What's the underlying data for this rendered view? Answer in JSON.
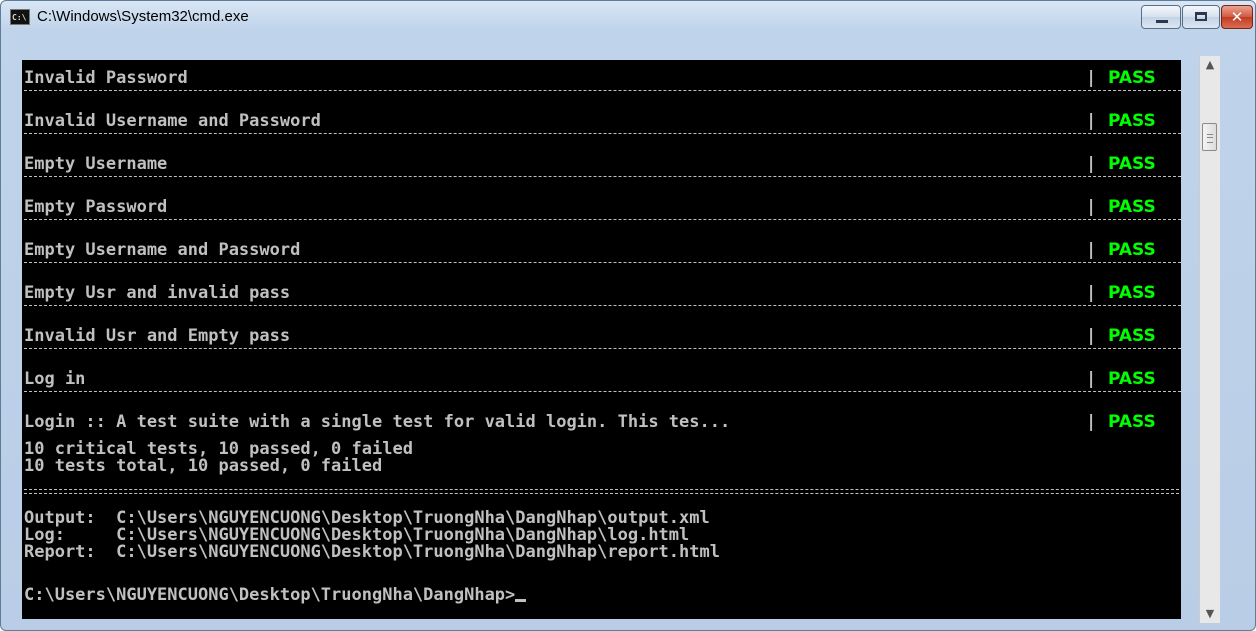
{
  "window": {
    "title": "C:\\Windows\\System32\\cmd.exe",
    "icon_text": "C:\\",
    "controls": {
      "minimize": "minimize",
      "maximize": "maximize",
      "close": "✕"
    }
  },
  "results": [
    {
      "name": "Invalid Password",
      "status": "PASS"
    },
    {
      "name": "Invalid Username and Password",
      "status": "PASS"
    },
    {
      "name": "Empty Username",
      "status": "PASS"
    },
    {
      "name": "Empty Password",
      "status": "PASS"
    },
    {
      "name": "Empty Username and Password",
      "status": "PASS"
    },
    {
      "name": "Empty Usr and invalid pass",
      "status": "PASS"
    },
    {
      "name": "Invalid Usr and Empty pass",
      "status": "PASS"
    },
    {
      "name": "Log in",
      "status": "PASS"
    },
    {
      "name": "Login :: A test suite with a single test for valid login. This tes...",
      "status": "PASS"
    }
  ],
  "separator_char": "|",
  "summary": {
    "critical": "10 critical tests, 10 passed, 0 failed",
    "total": "10 tests total, 10 passed, 0 failed"
  },
  "outputs": {
    "output": "Output:  C:\\Users\\NGUYENCUONG\\Desktop\\TruongNha\\DangNhap\\output.xml",
    "log": "Log:     C:\\Users\\NGUYENCUONG\\Desktop\\TruongNha\\DangNhap\\log.html",
    "report": "Report:  C:\\Users\\NGUYENCUONG\\Desktop\\TruongNha\\DangNhap\\report.html"
  },
  "prompt": "C:\\Users\\NGUYENCUONG\\Desktop\\TruongNha\\DangNhap>",
  "colors": {
    "console_bg": "#000000",
    "console_text": "#c0c0c0",
    "pass": "#00ff00"
  }
}
